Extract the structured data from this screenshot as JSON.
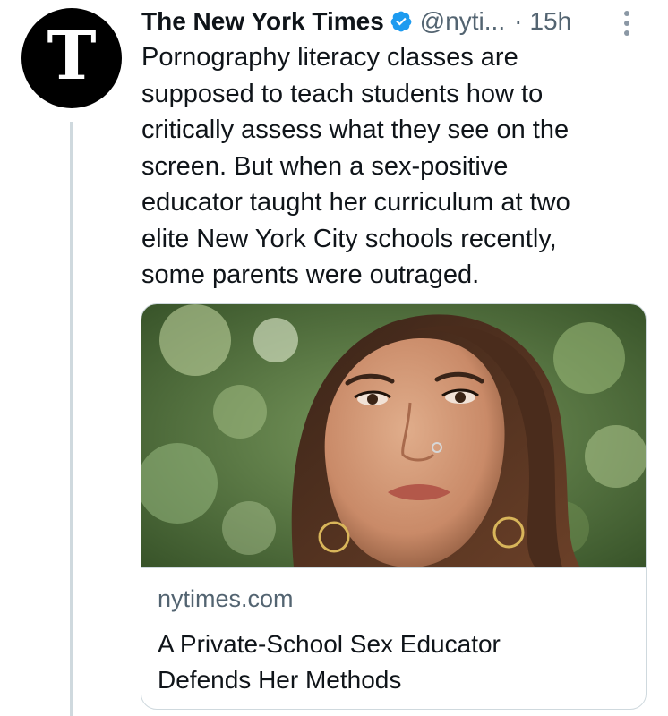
{
  "author": {
    "avatar_letter": "T",
    "name": "The New York Times",
    "handle": "@nyti...",
    "separator": "·",
    "time": "15h"
  },
  "tweet": {
    "lines": [
      "Pornography literacy classes are",
      "supposed to teach students how to",
      "critically assess what they see on the",
      "screen. But when a sex-positive",
      "educator taught her curriculum at two",
      "elite New York City schools recently,",
      "some parents were outraged."
    ]
  },
  "card": {
    "domain": "nytimes.com",
    "title_lines": [
      "A Private-School Sex Educator",
      "Defends Her Methods"
    ]
  },
  "colors": {
    "verified": "#1d9bf0",
    "secondary_text": "#536471",
    "border": "#cfd9de"
  }
}
